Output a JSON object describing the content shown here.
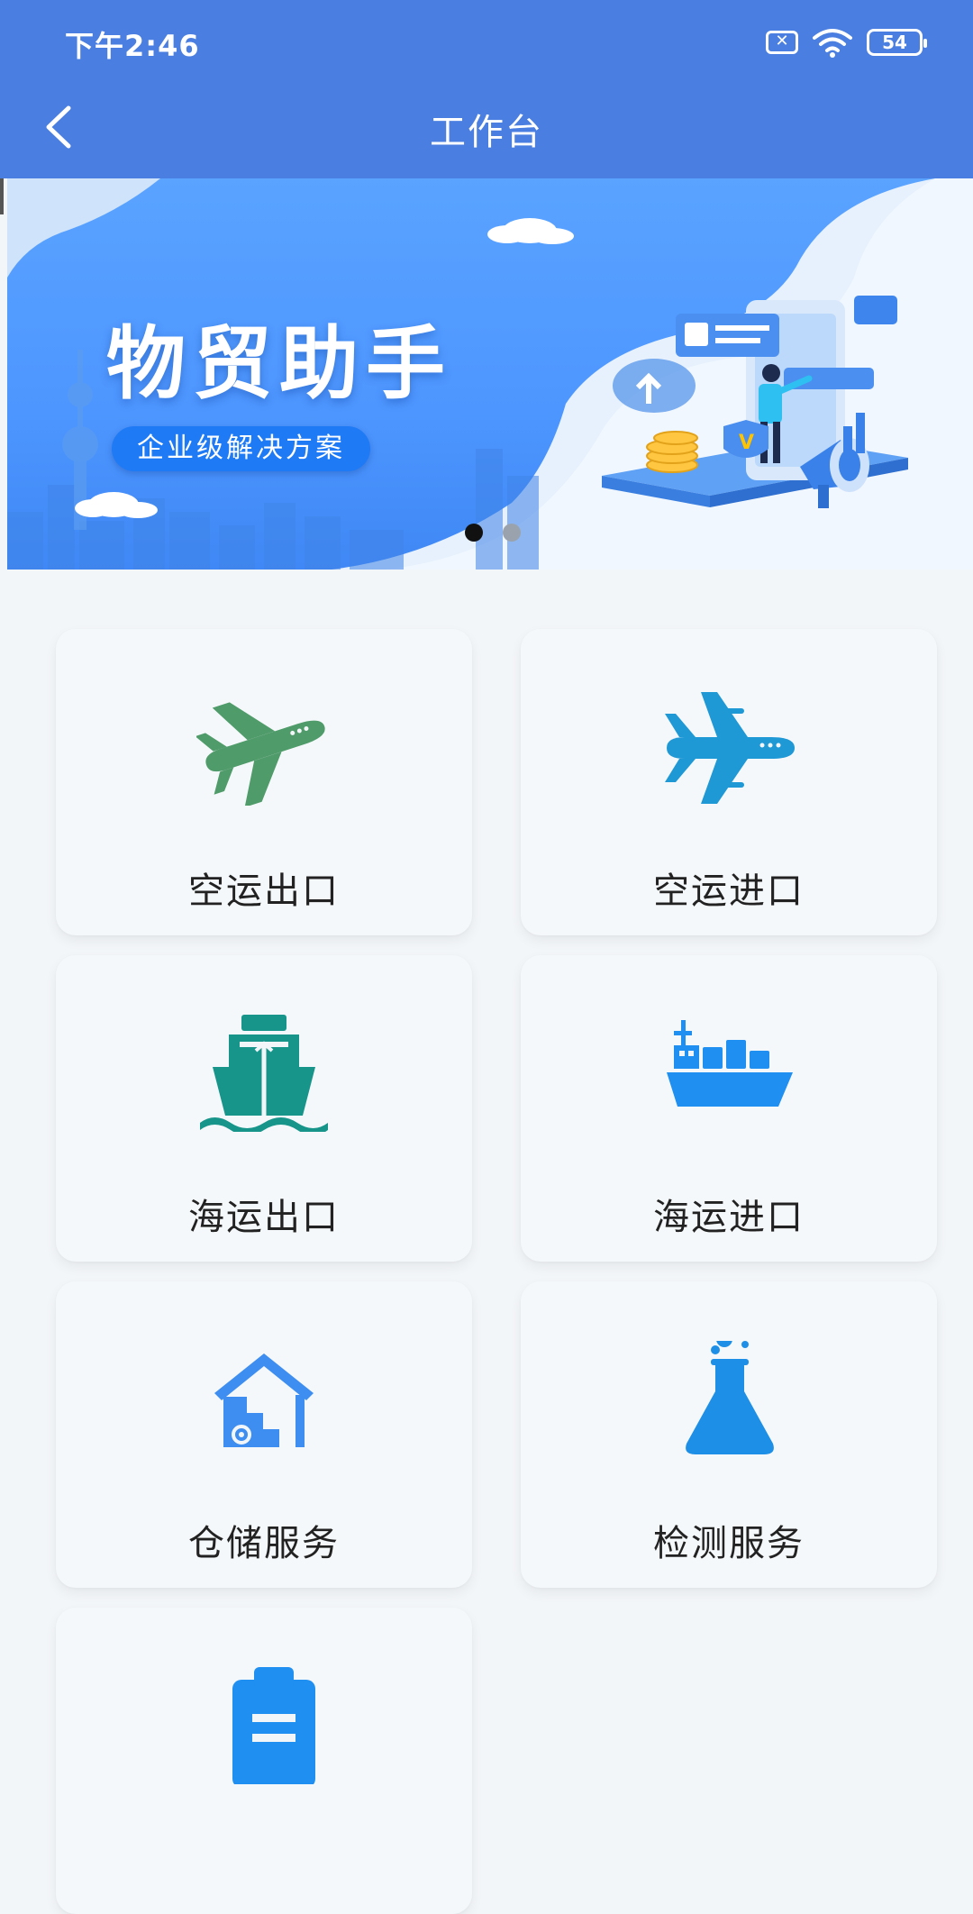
{
  "status_bar": {
    "time": "下午2:46",
    "battery": "54"
  },
  "header": {
    "title": "工作台"
  },
  "banner": {
    "title": "物贸助手",
    "subtitle": "企业级解决方案",
    "active_slide": 1,
    "slide_count": 2
  },
  "colors": {
    "header": "#4a7ee0",
    "banner": "#4d96ff",
    "air_export_icon": "#4f9b6a",
    "air_import_icon": "#1f98d6",
    "sea_export_icon": "#17958a",
    "sea_import_icon": "#1f8ff2",
    "warehouse_icon": "#3d8ef0",
    "testing_icon": "#1d8fe6"
  },
  "services": [
    {
      "label": "空运出口",
      "icon": "airplane-icon"
    },
    {
      "label": "空运进口",
      "icon": "airplane-icon"
    },
    {
      "label": "海运出口",
      "icon": "ship-icon"
    },
    {
      "label": "海运进口",
      "icon": "cargo-ship-icon"
    },
    {
      "label": "仓储服务",
      "icon": "warehouse-icon"
    },
    {
      "label": "检测服务",
      "icon": "flask-icon"
    },
    {
      "label": "",
      "icon": "clipboard-icon"
    }
  ]
}
